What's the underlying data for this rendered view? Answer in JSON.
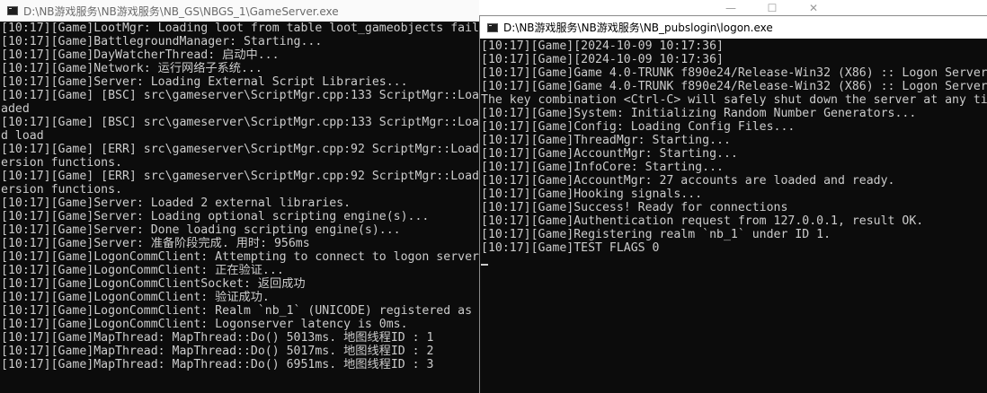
{
  "gameserver": {
    "title": "D:\\NB游戏服务\\NB游戏服务\\NB_GS\\NBGS_1\\GameServer.exe",
    "lines": [
      "[10:17][Game]LootMgr: Loading loot from table loot_gameobjects failed.",
      "[10:17][Game]BattlegroundManager: Starting...",
      "[10:17][Game]DayWatcherThread: 启动中...",
      "[10:17][Game]Network: 运行网络子系统...",
      "[10:17][Game]Server: Loading External Script Libraries...",
      "[10:17][Game] [BSC] src\\gameserver\\ScriptMgr.cpp:133 ScriptMgr::LoadScr",
      "aded",
      "[10:17][Game] [BSC] src\\gameserver\\ScriptMgr.cpp:133 ScriptMgr::LoadScr",
      "d load",
      "[10:17][Game] [ERR] src\\gameserver\\ScriptMgr.cpp:92 ScriptMgr::LoadScri",
      "ersion functions.",
      "[10:17][Game] [ERR] src\\gameserver\\ScriptMgr.cpp:92 ScriptMgr::LoadScri",
      "ersion functions.",
      "[10:17][Game]Server: Loaded 2 external libraries.",
      "[10:17][Game]Server: Loading optional scripting engine(s)...",
      "[10:17][Game]Server: Done loading scripting engine(s)...",
      "[10:17][Game]Server: 准备阶段完成. 用时: 956ms",
      "[10:17][Game]LogonCommClient: Attempting to connect to logon server...",
      "[10:17][Game]LogonCommClient: 正在验证...",
      "[10:17][Game]LogonCommClientSocket: 返回成功",
      "[10:17][Game]LogonCommClient: 验证成功.",
      "[10:17][Game]LogonCommClient: Realm `nb_1` (UNICODE) registered as realm",
      "[10:17][Game]LogonCommClient: Logonserver latency is 0ms.",
      "[10:17][Game]MapThread: MapThread::Do() 5013ms. 地图线程ID : 1",
      "[10:17][Game]MapThread: MapThread::Do() 5017ms. 地图线程ID : 2",
      "[10:17][Game]MapThread: MapThread::Do() 6951ms. 地图线程ID : 3"
    ]
  },
  "logon": {
    "title": "D:\\NB游戏服务\\NB游戏服务\\NB_pubslogin\\logon.exe",
    "lines": [
      "[10:17][Game][2024-10-09 10:17:36]",
      "[10:17][Game][2024-10-09 10:17:36]",
      "[10:17][Game]Game 4.0-TRUNK f890e24/Release-Win32 (X86) :: Logon Server",
      "[10:17][Game]Game 4.0-TRUNK f890e24/Release-Win32 (X86) :: Logon Server",
      "The key combination <Ctrl-C> will safely shut down the server at any time.",
      "[10:17][Game]System: Initializing Random Number Generators...",
      "[10:17][Game]Config: Loading Config Files...",
      "[10:17][Game]ThreadMgr: Starting...",
      "[10:17][Game]AccountMgr: Starting...",
      "[10:17][Game]InfoCore: Starting...",
      "[10:17][Game]AccountMgr: 27 accounts are loaded and ready.",
      "[10:17][Game]Hooking signals...",
      "[10:17][Game]Success! Ready for connections",
      "[10:17][Game]Authentication request from 127.0.0.1, result OK.",
      "[10:17][Game]Registering realm `nb_1` under ID 1.",
      "[10:17][Game]TEST FLAGS 0"
    ]
  },
  "window_controls": {
    "minimize": "—",
    "maximize": "☐",
    "close": "✕"
  }
}
